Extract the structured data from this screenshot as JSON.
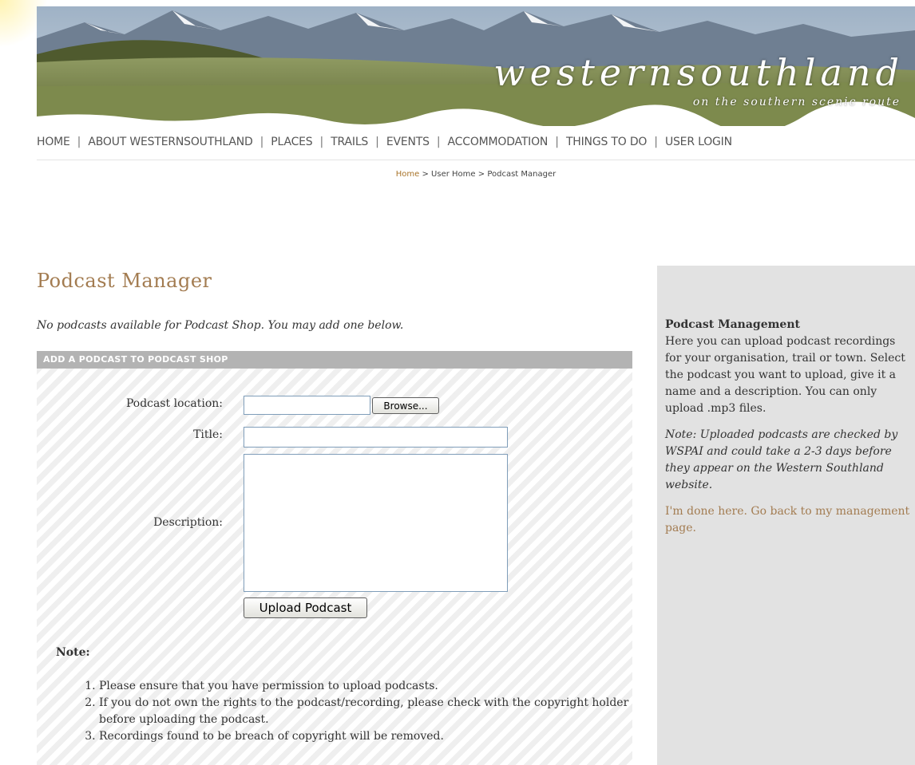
{
  "colors": {
    "accent": "#a37c51",
    "breadcrumb_home": "#a8742a",
    "panel_header_bg": "#b3b3b3",
    "sidebar_bg": "#e2e2e2",
    "nav_text": "#555555"
  },
  "banner": {
    "logo_main": "westernsouthland",
    "logo_sub": "on the southern scenic route"
  },
  "nav": {
    "items": [
      {
        "label": "HOME"
      },
      {
        "label": "ABOUT WESTERNSOUTHLAND"
      },
      {
        "label": "PLACES"
      },
      {
        "label": "TRAILS"
      },
      {
        "label": "EVENTS"
      },
      {
        "label": "ACCOMMODATION"
      },
      {
        "label": "THINGS TO DO"
      },
      {
        "label": "USER LOGIN"
      }
    ],
    "separator": "|"
  },
  "breadcrumb": {
    "home": "Home",
    "sep": ">",
    "user_home": "User Home",
    "current": "Podcast Manager"
  },
  "main": {
    "title": "Podcast Manager",
    "intro": "No podcasts available for Podcast Shop. You may add one below."
  },
  "form": {
    "header": "ADD A PODCAST TO PODCAST SHOP",
    "location_label": "Podcast location:",
    "location_value": "",
    "browse_label": "Browse...",
    "title_label": "Title:",
    "title_value": "",
    "description_label": "Description:",
    "description_value": "",
    "upload_label": "Upload Podcast"
  },
  "notes": {
    "title": "Note:",
    "items": [
      "Please ensure that you have permission to upload podcasts.",
      "If you do not own the rights to the podcast/recording, please check with the copyright holder before uploading the podcast.",
      "Recordings found to be breach of copyright will be removed."
    ]
  },
  "sidebar": {
    "title": "Podcast Management",
    "text": "Here you can upload podcast recordings for your organisation, trail or town. Select the podcast you want to upload, give it a name and a description. You can only upload .mp3 files.",
    "note": "Note: Uploaded podcasts are checked by WSPAI and could take a 2-3 days before they appear on the Western Southland website.",
    "link": "I'm done here. Go back to my management page."
  }
}
